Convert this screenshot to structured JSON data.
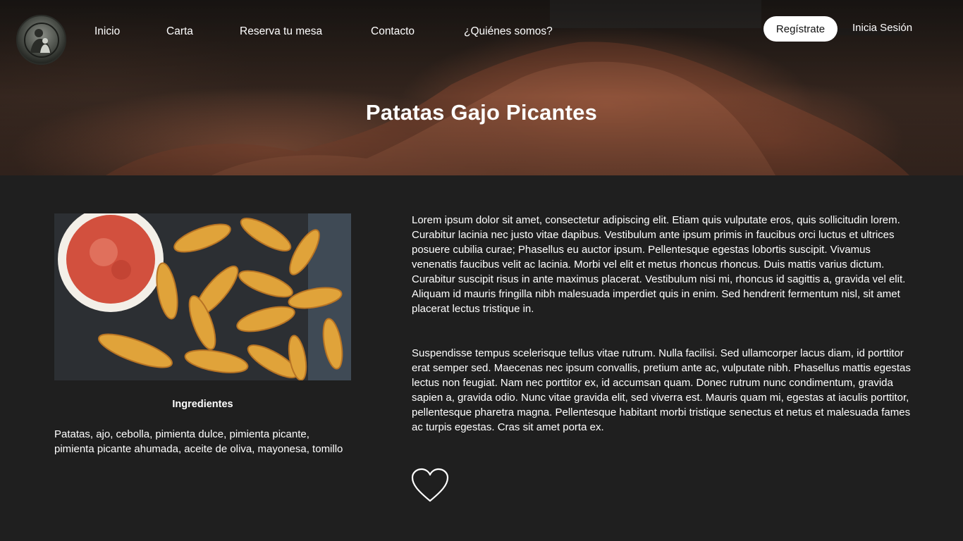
{
  "nav": {
    "items": [
      {
        "label": "Inicio"
      },
      {
        "label": "Carta"
      },
      {
        "label": "Reserva tu mesa"
      },
      {
        "label": "Contacto"
      },
      {
        "label": "¿Quiénes somos?"
      }
    ],
    "register_label": "Regístrate",
    "login_label": "Inicia Sesión"
  },
  "hero": {
    "title": "Patatas Gajo Picantes"
  },
  "ingredients": {
    "title": "Ingredientes",
    "text": "Patatas, ajo, cebolla, pimienta dulce, pimienta picante, pimienta picante ahumada, aceite de oliva, mayonesa, tomillo"
  },
  "description": {
    "paragraph1": "Lorem ipsum dolor sit amet, consectetur adipiscing elit. Etiam quis vulputate eros, quis sollicitudin lorem. Curabitur lacinia nec justo vitae dapibus. Vestibulum ante ipsum primis in faucibus orci luctus et ultrices posuere cubilia curae; Phasellus eu auctor ipsum. Pellentesque egestas lobortis suscipit. Vivamus venenatis faucibus velit ac lacinia. Morbi vel elit et metus rhoncus rhoncus. Duis mattis varius dictum. Curabitur suscipit risus in ante maximus placerat. Vestibulum nisi mi, rhoncus id sagittis a, gravida vel elit. Aliquam id mauris fringilla nibh malesuada imperdiet quis in enim. Sed hendrerit fermentum nisl, sit amet placerat lectus tristique in.",
    "paragraph2": "Suspendisse tempus scelerisque tellus vitae rutrum. Nulla facilisi. Sed ullamcorper lacus diam, id porttitor erat semper sed. Maecenas nec ipsum convallis, pretium ante ac, vulputate nibh. Phasellus mattis egestas lectus non feugiat. Nam nec porttitor ex, id accumsan quam. Donec rutrum nunc condimentum, gravida sapien a, gravida odio. Nunc vitae gravida elit, sed viverra est. Mauris quam mi, egestas at iaculis porttitor, pellentesque pharetra magna. Pellentesque habitant morbi tristique senectus et netus et malesuada fames ac turpis egestas. Cras sit amet porta ex."
  },
  "icons": {
    "logo": "restaurant-logo",
    "favorite": "heart-icon"
  },
  "colors": {
    "page_background": "#1f1f1f",
    "text": "#ffffff",
    "register_button_bg": "#ffffff",
    "register_button_text": "#111111"
  }
}
